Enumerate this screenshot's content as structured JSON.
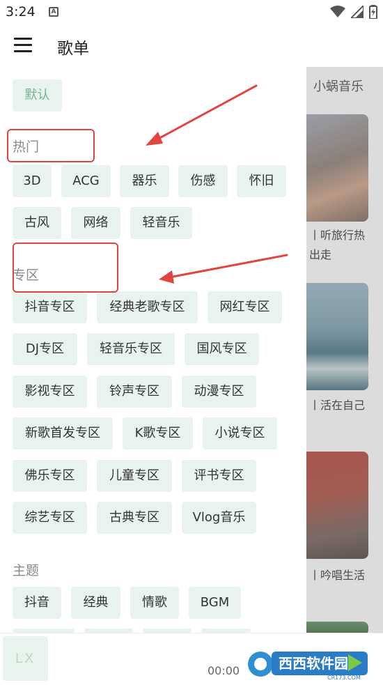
{
  "status_bar": {
    "time": "3:24",
    "notification_icon": "a-letter-icon",
    "icons": [
      "wifi-icon",
      "signal-icon",
      "battery-icon"
    ]
  },
  "toolbar": {
    "title": "歌单",
    "menu_icon": "menu-icon"
  },
  "background_page": {
    "title": "小蜗音乐",
    "items": [
      "丨听旅行热",
      "出走",
      "丨活在自己",
      "丨吟唱生活"
    ]
  },
  "drawer": {
    "default_tag": "默认",
    "sections": [
      {
        "title": "热门",
        "tags": [
          "3D",
          "ACG",
          "器乐",
          "伤感",
          "怀旧",
          "古风",
          "网络",
          "轻音乐"
        ]
      },
      {
        "title": "专区",
        "tags": [
          "抖音专区",
          "经典老歌专区",
          "网红专区",
          "DJ专区",
          "轻音乐专区",
          "国风专区",
          "影视专区",
          "铃声专区",
          "动漫专区",
          "新歌首发专区",
          "K歌专区",
          "小说专区",
          "佛乐专区",
          "儿童专区",
          "评书专区",
          "综艺专区",
          "古典专区",
          "Vlog音乐"
        ]
      },
      {
        "title": "主题",
        "tags": [
          "抖音",
          "经典",
          "情歌",
          "BGM"
        ]
      }
    ]
  },
  "player": {
    "cover_text": "LX",
    "time": "00:00"
  },
  "watermark": {
    "brand": "西西软件园",
    "url": "CR173.COM"
  },
  "colors": {
    "accent": "#6fb791",
    "tag_background": "#e9f3ed",
    "annotation": "#e2453f"
  }
}
